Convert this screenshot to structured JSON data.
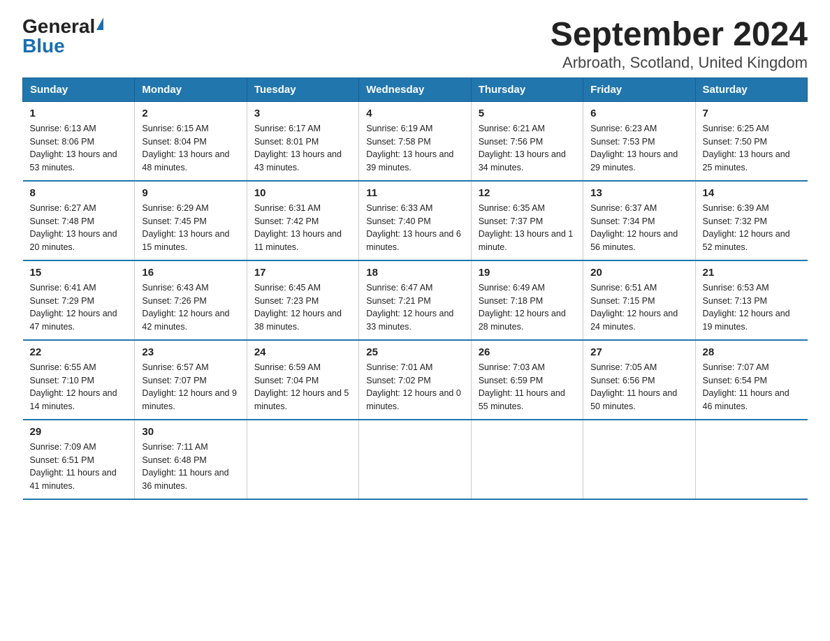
{
  "logo": {
    "general": "General",
    "blue": "Blue"
  },
  "title": "September 2024",
  "subtitle": "Arbroath, Scotland, United Kingdom",
  "weekdays": [
    "Sunday",
    "Monday",
    "Tuesday",
    "Wednesday",
    "Thursday",
    "Friday",
    "Saturday"
  ],
  "weeks": [
    [
      {
        "day": "1",
        "sunrise": "6:13 AM",
        "sunset": "8:06 PM",
        "daylight": "13 hours and 53 minutes."
      },
      {
        "day": "2",
        "sunrise": "6:15 AM",
        "sunset": "8:04 PM",
        "daylight": "13 hours and 48 minutes."
      },
      {
        "day": "3",
        "sunrise": "6:17 AM",
        "sunset": "8:01 PM",
        "daylight": "13 hours and 43 minutes."
      },
      {
        "day": "4",
        "sunrise": "6:19 AM",
        "sunset": "7:58 PM",
        "daylight": "13 hours and 39 minutes."
      },
      {
        "day": "5",
        "sunrise": "6:21 AM",
        "sunset": "7:56 PM",
        "daylight": "13 hours and 34 minutes."
      },
      {
        "day": "6",
        "sunrise": "6:23 AM",
        "sunset": "7:53 PM",
        "daylight": "13 hours and 29 minutes."
      },
      {
        "day": "7",
        "sunrise": "6:25 AM",
        "sunset": "7:50 PM",
        "daylight": "13 hours and 25 minutes."
      }
    ],
    [
      {
        "day": "8",
        "sunrise": "6:27 AM",
        "sunset": "7:48 PM",
        "daylight": "13 hours and 20 minutes."
      },
      {
        "day": "9",
        "sunrise": "6:29 AM",
        "sunset": "7:45 PM",
        "daylight": "13 hours and 15 minutes."
      },
      {
        "day": "10",
        "sunrise": "6:31 AM",
        "sunset": "7:42 PM",
        "daylight": "13 hours and 11 minutes."
      },
      {
        "day": "11",
        "sunrise": "6:33 AM",
        "sunset": "7:40 PM",
        "daylight": "13 hours and 6 minutes."
      },
      {
        "day": "12",
        "sunrise": "6:35 AM",
        "sunset": "7:37 PM",
        "daylight": "13 hours and 1 minute."
      },
      {
        "day": "13",
        "sunrise": "6:37 AM",
        "sunset": "7:34 PM",
        "daylight": "12 hours and 56 minutes."
      },
      {
        "day": "14",
        "sunrise": "6:39 AM",
        "sunset": "7:32 PM",
        "daylight": "12 hours and 52 minutes."
      }
    ],
    [
      {
        "day": "15",
        "sunrise": "6:41 AM",
        "sunset": "7:29 PM",
        "daylight": "12 hours and 47 minutes."
      },
      {
        "day": "16",
        "sunrise": "6:43 AM",
        "sunset": "7:26 PM",
        "daylight": "12 hours and 42 minutes."
      },
      {
        "day": "17",
        "sunrise": "6:45 AM",
        "sunset": "7:23 PM",
        "daylight": "12 hours and 38 minutes."
      },
      {
        "day": "18",
        "sunrise": "6:47 AM",
        "sunset": "7:21 PM",
        "daylight": "12 hours and 33 minutes."
      },
      {
        "day": "19",
        "sunrise": "6:49 AM",
        "sunset": "7:18 PM",
        "daylight": "12 hours and 28 minutes."
      },
      {
        "day": "20",
        "sunrise": "6:51 AM",
        "sunset": "7:15 PM",
        "daylight": "12 hours and 24 minutes."
      },
      {
        "day": "21",
        "sunrise": "6:53 AM",
        "sunset": "7:13 PM",
        "daylight": "12 hours and 19 minutes."
      }
    ],
    [
      {
        "day": "22",
        "sunrise": "6:55 AM",
        "sunset": "7:10 PM",
        "daylight": "12 hours and 14 minutes."
      },
      {
        "day": "23",
        "sunrise": "6:57 AM",
        "sunset": "7:07 PM",
        "daylight": "12 hours and 9 minutes."
      },
      {
        "day": "24",
        "sunrise": "6:59 AM",
        "sunset": "7:04 PM",
        "daylight": "12 hours and 5 minutes."
      },
      {
        "day": "25",
        "sunrise": "7:01 AM",
        "sunset": "7:02 PM",
        "daylight": "12 hours and 0 minutes."
      },
      {
        "day": "26",
        "sunrise": "7:03 AM",
        "sunset": "6:59 PM",
        "daylight": "11 hours and 55 minutes."
      },
      {
        "day": "27",
        "sunrise": "7:05 AM",
        "sunset": "6:56 PM",
        "daylight": "11 hours and 50 minutes."
      },
      {
        "day": "28",
        "sunrise": "7:07 AM",
        "sunset": "6:54 PM",
        "daylight": "11 hours and 46 minutes."
      }
    ],
    [
      {
        "day": "29",
        "sunrise": "7:09 AM",
        "sunset": "6:51 PM",
        "daylight": "11 hours and 41 minutes."
      },
      {
        "day": "30",
        "sunrise": "7:11 AM",
        "sunset": "6:48 PM",
        "daylight": "11 hours and 36 minutes."
      },
      null,
      null,
      null,
      null,
      null
    ]
  ]
}
